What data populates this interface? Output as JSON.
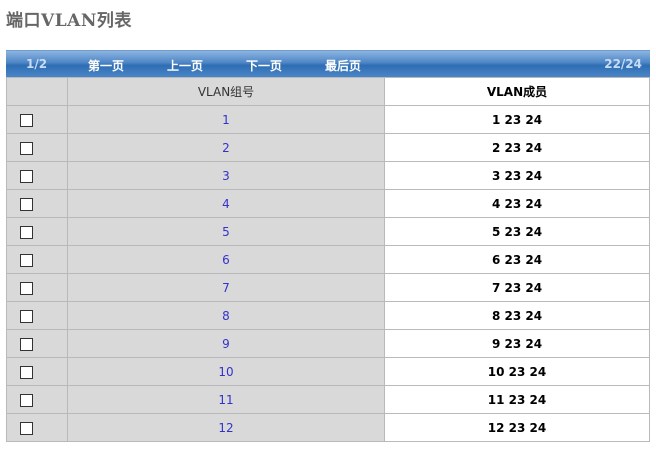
{
  "page": {
    "title": "端口VLAN列表"
  },
  "pager": {
    "page_info": "1/2",
    "first": "第一页",
    "prev": "上一页",
    "next": "下一页",
    "last": "最后页",
    "record_count": "22/24"
  },
  "table": {
    "headers": {
      "select": "",
      "vlan_id": "VLAN组号",
      "members": "VLAN成员"
    },
    "rows": [
      {
        "vlan_id": "1",
        "members": "1 23 24",
        "checked": false
      },
      {
        "vlan_id": "2",
        "members": "2 23 24",
        "checked": false
      },
      {
        "vlan_id": "3",
        "members": "3 23 24",
        "checked": false
      },
      {
        "vlan_id": "4",
        "members": "4 23 24",
        "checked": false
      },
      {
        "vlan_id": "5",
        "members": "5 23 24",
        "checked": false
      },
      {
        "vlan_id": "6",
        "members": "6 23 24",
        "checked": false
      },
      {
        "vlan_id": "7",
        "members": "7 23 24",
        "checked": false
      },
      {
        "vlan_id": "8",
        "members": "8 23 24",
        "checked": false
      },
      {
        "vlan_id": "9",
        "members": "9 23 24",
        "checked": false
      },
      {
        "vlan_id": "10",
        "members": "10 23 24",
        "checked": false
      },
      {
        "vlan_id": "11",
        "members": "11 23 24",
        "checked": false
      },
      {
        "vlan_id": "12",
        "members": "12 23 24",
        "checked": false
      }
    ]
  }
}
